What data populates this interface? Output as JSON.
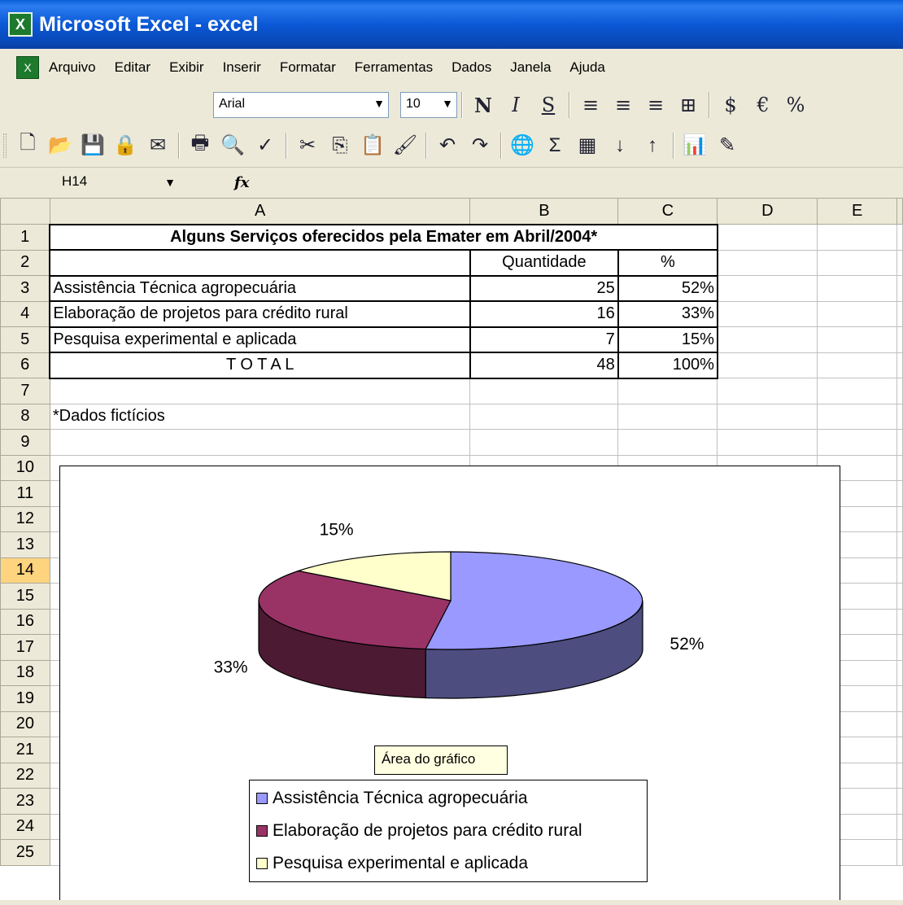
{
  "window": {
    "title": "Microsoft Excel - excel",
    "app_icon": "X"
  },
  "menu": [
    "Arquivo",
    "Editar",
    "Exibir",
    "Inserir",
    "Formatar",
    "Ferramentas",
    "Dados",
    "Janela",
    "Ajuda"
  ],
  "format_toolbar": {
    "font": "Arial",
    "size": "10",
    "buttons": [
      {
        "name": "bold-button",
        "glyph": "N"
      },
      {
        "name": "italic-button",
        "glyph": "I"
      },
      {
        "name": "underline-button",
        "glyph": "S"
      },
      {
        "name": "align-left-icon",
        "glyph": "≡"
      },
      {
        "name": "align-center-icon",
        "glyph": "≡"
      },
      {
        "name": "align-right-icon",
        "glyph": "≡"
      },
      {
        "name": "merge-center-icon",
        "glyph": "⊞"
      },
      {
        "name": "currency-icon",
        "glyph": "$"
      },
      {
        "name": "euro-icon",
        "glyph": "€"
      },
      {
        "name": "percent-icon",
        "glyph": "%"
      }
    ]
  },
  "std_toolbar": [
    {
      "name": "new-icon",
      "glyph": "🗋"
    },
    {
      "name": "open-icon",
      "glyph": "📂"
    },
    {
      "name": "save-icon",
      "glyph": "💾"
    },
    {
      "name": "permission-icon",
      "glyph": "🔒"
    },
    {
      "name": "email-icon",
      "glyph": "✉"
    },
    {
      "name": "sep"
    },
    {
      "name": "print-icon",
      "glyph": "🖶"
    },
    {
      "name": "print-preview-icon",
      "glyph": "🔍"
    },
    {
      "name": "spelling-icon",
      "glyph": "✓"
    },
    {
      "name": "sep"
    },
    {
      "name": "cut-icon",
      "glyph": "✂"
    },
    {
      "name": "copy-icon",
      "glyph": "⎘"
    },
    {
      "name": "paste-icon",
      "glyph": "📋"
    },
    {
      "name": "format-painter-icon",
      "glyph": "🖌"
    },
    {
      "name": "sep"
    },
    {
      "name": "undo-icon",
      "glyph": "↶"
    },
    {
      "name": "redo-icon",
      "glyph": "↷"
    },
    {
      "name": "sep"
    },
    {
      "name": "hyperlink-icon",
      "glyph": "🌐"
    },
    {
      "name": "autosum-icon",
      "glyph": "Σ"
    },
    {
      "name": "function-icon",
      "glyph": "▦"
    },
    {
      "name": "sort-asc-icon",
      "glyph": "↓"
    },
    {
      "name": "sort-desc-icon",
      "glyph": "↑"
    },
    {
      "name": "sep"
    },
    {
      "name": "chart-wizard-icon",
      "glyph": "📊"
    },
    {
      "name": "drawing-icon",
      "glyph": "✎"
    }
  ],
  "formula_bar": {
    "name_box": "H14",
    "fx": "fx",
    "value": ""
  },
  "columns": [
    "A",
    "B",
    "C",
    "D",
    "E"
  ],
  "rows": [
    "1",
    "2",
    "3",
    "4",
    "5",
    "6",
    "7",
    "8",
    "9",
    "10",
    "11",
    "12",
    "13",
    "14",
    "15",
    "16",
    "17",
    "18",
    "19",
    "20",
    "21",
    "22",
    "23",
    "24",
    "25"
  ],
  "selected_row": "14",
  "cells": {
    "title": "Alguns Serviços oferecidos pela Emater em Abril/2004*",
    "header_qty": "Quantidade",
    "header_pct": "%",
    "data": [
      {
        "label": "Assistência Técnica agropecuária",
        "qty": "25",
        "pct": "52%"
      },
      {
        "label": "Elaboração de projetos para crédito rural",
        "qty": "16",
        "pct": "33%"
      },
      {
        "label": "Pesquisa experimental e aplicada",
        "qty": "7",
        "pct": "15%"
      }
    ],
    "total_label": "T O T A L",
    "total_qty": "48",
    "total_pct": "100%",
    "note": "*Dados fictícios"
  },
  "chart_tooltip": "Área do gráfico",
  "chart_data": {
    "type": "pie",
    "title": "",
    "series": [
      {
        "name": "Assistência Técnica agropecuária",
        "value": 25,
        "label": "52%",
        "color": "#9999ff"
      },
      {
        "name": "Elaboração de projetos para crédito rural",
        "value": 16,
        "label": "33%",
        "color": "#993366"
      },
      {
        "name": "Pesquisa experimental e aplicada",
        "value": 7,
        "label": "15%",
        "color": "#ffffcc"
      }
    ],
    "legend": "bottom-center",
    "three_d": true
  }
}
